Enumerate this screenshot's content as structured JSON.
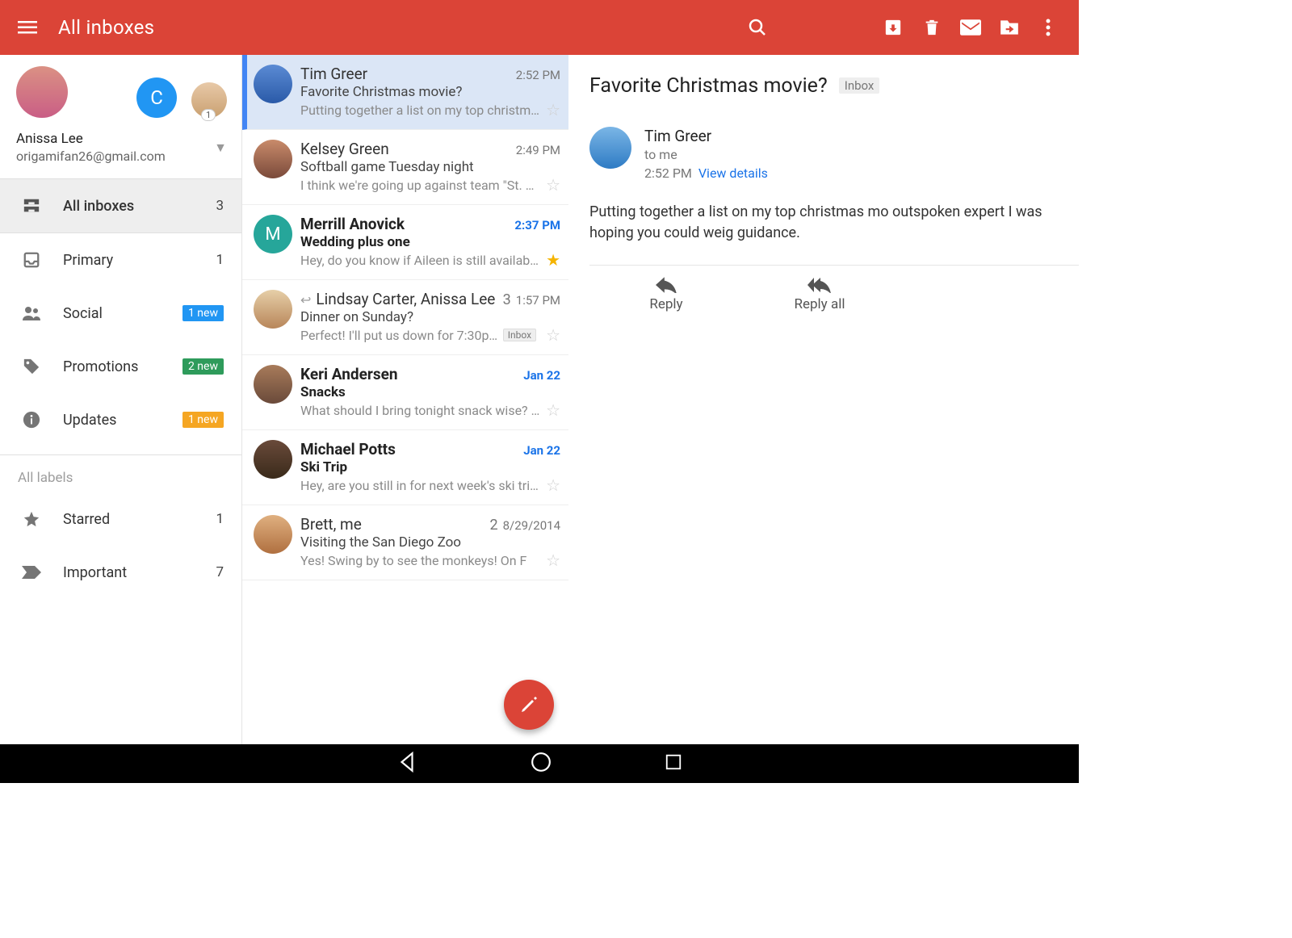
{
  "appbar": {
    "title": "All inboxes"
  },
  "account": {
    "name": "Anissa Lee",
    "email": "origamifan26@gmail.com",
    "switcher_letter": "C",
    "small_badge": "1"
  },
  "nav": {
    "items": [
      {
        "label": "All inboxes",
        "count": "3"
      },
      {
        "label": "Primary",
        "count": "1"
      },
      {
        "label": "Social",
        "chip": "1 new",
        "chip_color": "blue"
      },
      {
        "label": "Promotions",
        "chip": "2 new",
        "chip_color": "green"
      },
      {
        "label": "Updates",
        "chip": "1 new",
        "chip_color": "amber"
      }
    ],
    "labels_header": "All labels",
    "labels": [
      {
        "label": "Starred",
        "count": "1"
      },
      {
        "label": "Important",
        "count": "7"
      }
    ]
  },
  "messages": [
    {
      "sender": "Tim Greer",
      "time": "2:52 PM",
      "subject": "Favorite Christmas movie?",
      "snippet": "Putting together a list on my top christmas...",
      "selected": true
    },
    {
      "sender": "Kelsey Green",
      "time": "2:49 PM",
      "subject": "Softball game Tuesday night",
      "snippet": "I think we're going up against team \"St. El..."
    },
    {
      "sender": "Merrill Anovick",
      "time": "2:37 PM",
      "subject": "Wedding plus one",
      "snippet": "Hey, do you know if Aileen is still available...",
      "unread": true,
      "starred": true,
      "letter": "M"
    },
    {
      "sender": "Lindsay Carter, Anissa Lee",
      "thread_count": "3",
      "time": "1:57 PM",
      "subject": "Dinner on Sunday?",
      "snippet": "Perfect! I'll put us down for 7:30pm....",
      "has_reply_icon": true,
      "inbox_chip": "Inbox"
    },
    {
      "sender": "Keri Andersen",
      "time": "Jan 22",
      "subject": "Snacks",
      "snippet": "What should I bring tonight snack wise? I t...",
      "unread": true
    },
    {
      "sender": "Michael Potts",
      "time": "Jan 22",
      "subject": "Ski Trip",
      "snippet": "Hey, are you still in for next week's ski trip?...",
      "unread": true
    },
    {
      "sender": "Brett, me",
      "thread_count": "2",
      "time": "8/29/2014",
      "subject": "Visiting the San Diego Zoo",
      "snippet": "Yes! Swing by to see the monkeys! On F"
    }
  ],
  "reader": {
    "subject": "Favorite Christmas movie?",
    "label": "Inbox",
    "from": "Tim Greer",
    "to": "to me",
    "time": "2:52 PM",
    "details": "View details",
    "body": "Putting together a list on my top christmas mo outspoken expert I was hoping you could weig guidance.",
    "reply": "Reply",
    "reply_all": "Reply all"
  }
}
